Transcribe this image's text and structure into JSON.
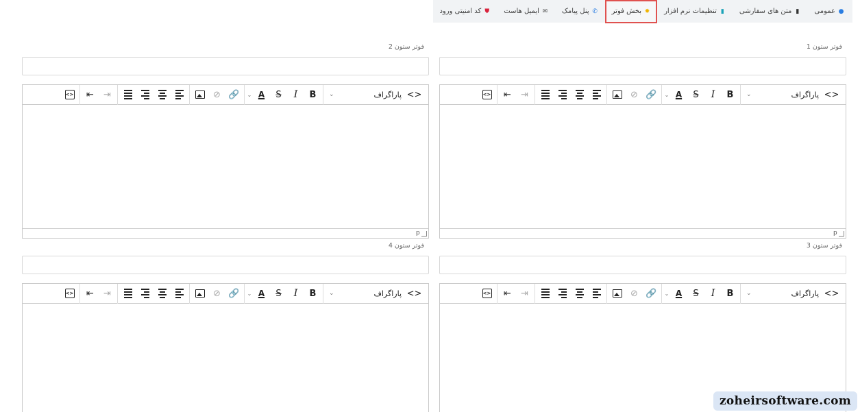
{
  "tabs": [
    {
      "label": "عمومی",
      "icon": "info-circle-icon",
      "icon_glyph": "●",
      "icon_color": "#2a7de1",
      "active": false
    },
    {
      "label": "متن های سفارشی",
      "icon": "file-icon",
      "icon_glyph": "▮",
      "icon_color": "#333333",
      "active": false
    },
    {
      "label": "تنظیمات نرم افزار",
      "icon": "file-icon",
      "icon_glyph": "▮",
      "icon_color": "#1aa3b8",
      "active": false
    },
    {
      "label": "بخش فوتر",
      "icon": "gear-icon",
      "icon_glyph": "✹",
      "icon_color": "#f0b400",
      "active": true
    },
    {
      "label": "پنل پیامک",
      "icon": "phone-icon",
      "icon_glyph": "✆",
      "icon_color": "#2a7de1",
      "active": false
    },
    {
      "label": "ایمیل هاست",
      "icon": "envelope-icon",
      "icon_glyph": "✉",
      "icon_color": "#555555",
      "active": false
    },
    {
      "label": "کد امنیتی ورود",
      "icon": "shield-icon",
      "icon_glyph": "⛊",
      "icon_color": "#d9233c",
      "active": false
    }
  ],
  "editors": {
    "col1": {
      "label": "فوتر ستون 1",
      "status_path": "p"
    },
    "col2": {
      "label": "فوتر ستون 2",
      "status_path": "p"
    },
    "col3": {
      "label": "فوتر ستون 3"
    },
    "col4": {
      "label": "فوتر ستون 4"
    }
  },
  "toolbar": {
    "format_label": "پاراگراف",
    "code_glyph": "<>",
    "bold": "B",
    "italic": "I",
    "strike": "S",
    "font_color": "A"
  },
  "accent_color": "#e0514f",
  "watermark": "zoheirsoftware.com"
}
